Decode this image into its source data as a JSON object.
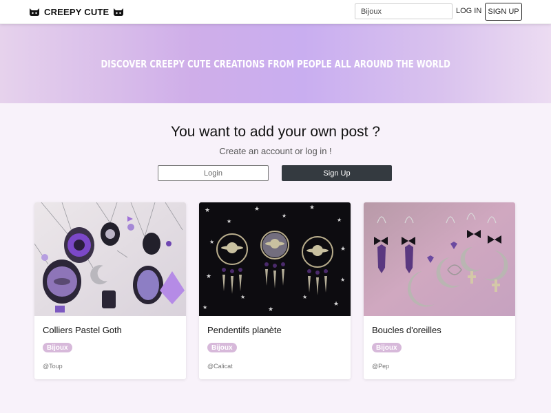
{
  "brand": {
    "name": "CREEPY CUTE"
  },
  "nav": {
    "search_value": "Bijoux",
    "login_label": "LOG IN",
    "signup_label": "SIGN UP"
  },
  "hero": {
    "title": "Discover creepy cute creations from people all around the world"
  },
  "cta": {
    "title": "You want to add your own post ?",
    "subtitle": "Create an account or log in !",
    "login_label": "Login",
    "signup_label": "Sign Up"
  },
  "cards": [
    {
      "title": "Colliers Pastel Goth",
      "badge": "Bijoux",
      "author": "@Toup",
      "image": "pastel-goth-necklaces-photo"
    },
    {
      "title": "Pendentifs planète",
      "badge": "Bijoux",
      "author": "@Calicat",
      "image": "planet-pendants-photo"
    },
    {
      "title": "Boucles d'oreilles",
      "badge": "Bijoux",
      "author": "@Pep",
      "image": "moon-earrings-photo"
    }
  ],
  "colors": {
    "accent": "#c9aef0",
    "badge": "#d7b9da",
    "dark_button": "#343a40"
  }
}
